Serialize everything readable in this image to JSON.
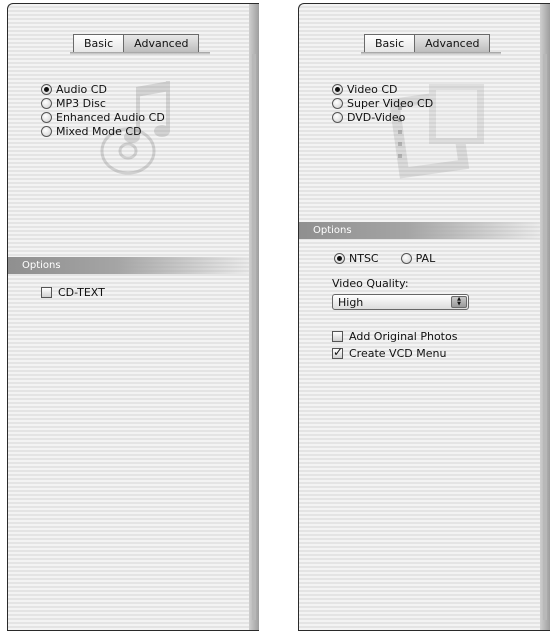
{
  "left_panel": {
    "tabs": [
      {
        "label": "Basic",
        "active": false
      },
      {
        "label": "Advanced",
        "active": true
      }
    ],
    "format_options": [
      {
        "label": "Audio CD",
        "selected": true
      },
      {
        "label": "MP3 Disc",
        "selected": false
      },
      {
        "label": "Enhanced Audio CD",
        "selected": false
      },
      {
        "label": "Mixed Mode CD",
        "selected": false
      }
    ],
    "watermark_icon": "music-cd-icon",
    "options_header": "Options",
    "cd_text": {
      "label": "CD-TEXT",
      "checked": false
    }
  },
  "right_panel": {
    "tabs": [
      {
        "label": "Basic",
        "active": false
      },
      {
        "label": "Advanced",
        "active": true
      }
    ],
    "format_options": [
      {
        "label": "Video CD",
        "selected": true
      },
      {
        "label": "Super Video CD",
        "selected": false
      },
      {
        "label": "DVD-Video",
        "selected": false
      }
    ],
    "watermark_icon": "film-cd-icon",
    "options_header": "Options",
    "video_standard": [
      {
        "label": "NTSC",
        "selected": true
      },
      {
        "label": "PAL",
        "selected": false
      }
    ],
    "video_quality_label": "Video Quality:",
    "video_quality_value": "High",
    "add_original_photos": {
      "label": "Add Original Photos",
      "checked": false
    },
    "create_vcd_menu": {
      "label": "Create VCD Menu",
      "checked": true
    }
  }
}
